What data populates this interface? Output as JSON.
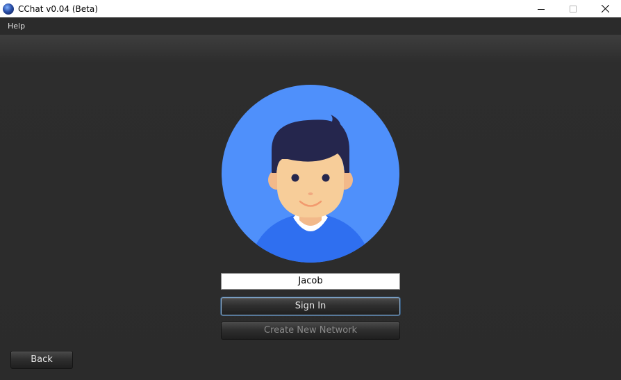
{
  "window": {
    "title": "CChat v0.04 (Beta)",
    "controls": [
      "minimize",
      "maximize",
      "close"
    ]
  },
  "menu": {
    "help_label": "Help"
  },
  "login": {
    "username_value": "Jacob",
    "sign_in_label": "Sign In",
    "create_network_label": "Create New Network",
    "back_label": "Back"
  },
  "colors": {
    "avatar_bg": "#4f90fb",
    "shirt": "#2f6ff0",
    "hair": "#25264d",
    "skin": "#f7cd99"
  }
}
